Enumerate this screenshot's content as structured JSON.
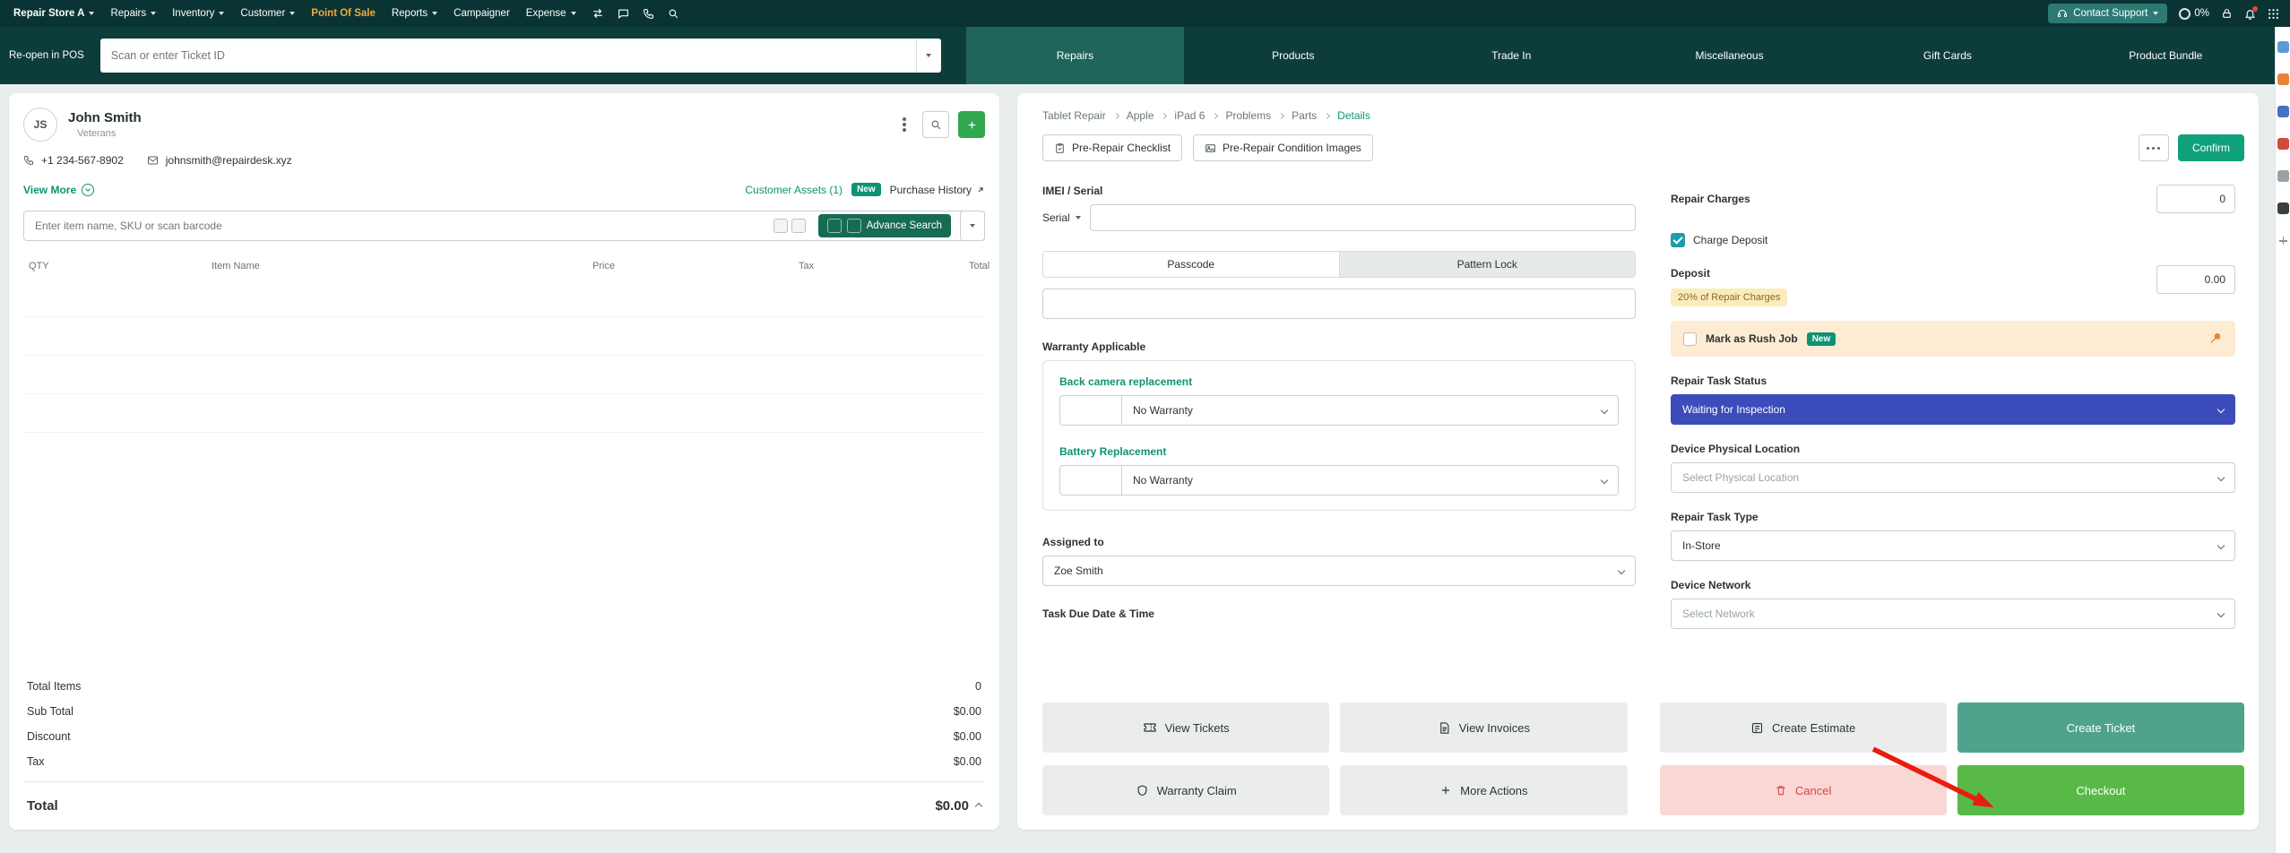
{
  "colors": {
    "accent_teal": "#0e9373",
    "pos_highlight_orange": "#f2a93b",
    "status_blue": "#3c4cbb",
    "checkout_green": "#58b947",
    "cancel_red": "#d9443f"
  },
  "topnav": {
    "store_label": "Repair Store A",
    "menu": [
      "Repairs",
      "Inventory",
      "Customer",
      "Point Of Sale",
      "Reports",
      "Campaigner",
      "Expense"
    ],
    "contact_support_label": "Contact Support",
    "progress_label": "0%"
  },
  "posbar": {
    "reopen_label": "Re-open in POS",
    "search_placeholder": "Scan or enter Ticket ID",
    "tabs": [
      "Repairs",
      "Products",
      "Trade In",
      "Miscellaneous",
      "Gift Cards",
      "Product Bundle"
    ]
  },
  "customer": {
    "initials": "JS",
    "name": "John Smith",
    "group": "Veterans",
    "phone": "+1 234-567-8902",
    "email": "johnsmith@repairdesk.xyz",
    "view_more_label": "View More",
    "assets_label": "Customer Assets (1)",
    "assets_badge": "New",
    "purchase_history_label": "Purchase History"
  },
  "cart": {
    "search_placeholder": "Enter item name, SKU or scan barcode",
    "advance_search_label": "Advance Search",
    "columns": [
      "QTY",
      "Item Name",
      "Price",
      "Tax",
      "Total"
    ],
    "totals": [
      {
        "label": "Total Items",
        "value": "0"
      },
      {
        "label": "Sub Total",
        "value": "$0.00"
      },
      {
        "label": "Discount",
        "value": "$0.00"
      },
      {
        "label": "Tax",
        "value": "$0.00"
      }
    ],
    "total_label": "Total",
    "total_value": "$0.00"
  },
  "repair": {
    "breadcrumb": [
      "Tablet Repair",
      "Apple",
      "iPad 6",
      "Problems",
      "Parts",
      "Details"
    ],
    "pre_repair_checklist_label": "Pre-Repair Checklist",
    "pre_repair_images_label": "Pre-Repair Condition Images",
    "confirm_label": "Confirm",
    "imei_label": "IMEI / Serial",
    "serial_prefix": "Serial",
    "passcode_tab": "Passcode",
    "pattern_tab": "Pattern Lock",
    "warranty_label": "Warranty Applicable",
    "warranty_items": [
      {
        "name": "Back camera replacement",
        "value": "No Warranty"
      },
      {
        "name": "Battery Replacement",
        "value": "No Warranty"
      }
    ],
    "assigned_label": "Assigned to",
    "assigned_value": "Zoe Smith",
    "due_label": "Task Due Date & Time",
    "charges_label": "Repair Charges",
    "charges_value": "0",
    "charge_deposit_label": "Charge Deposit",
    "deposit_label": "Deposit",
    "deposit_value": "0.00",
    "deposit_hint": "20% of Repair Charges",
    "rush_label": "Mark as Rush Job",
    "rush_badge": "New",
    "status_label": "Repair Task Status",
    "status_value": "Waiting for Inspection",
    "location_label": "Device Physical Location",
    "location_placeholder": "Select Physical Location",
    "type_label": "Repair Task Type",
    "type_value": "In-Store",
    "network_label": "Device Network",
    "network_placeholder": "Select Network"
  },
  "actions": {
    "view_tickets": "View Tickets",
    "view_invoices": "View Invoices",
    "create_estimate": "Create Estimate",
    "create_ticket": "Create Ticket",
    "warranty_claim": "Warranty Claim",
    "more_actions": "More Actions",
    "cancel": "Cancel",
    "checkout": "Checkout"
  }
}
